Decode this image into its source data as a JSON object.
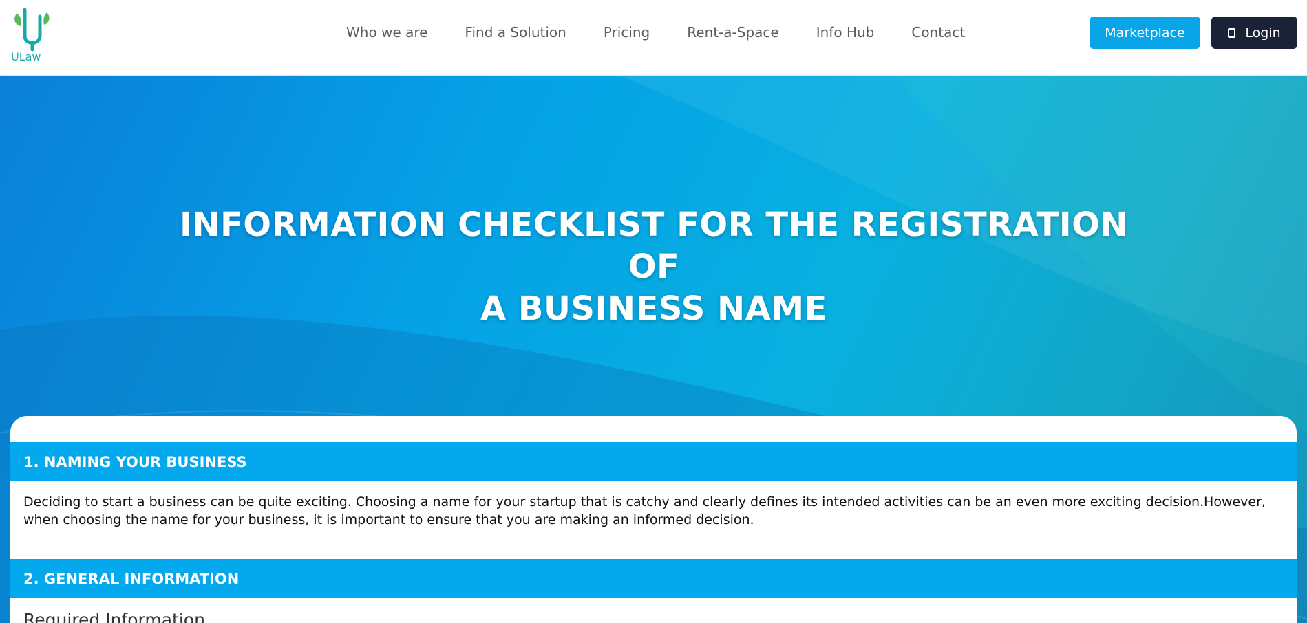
{
  "header": {
    "logo_text": "ULaw",
    "nav": [
      "Who we are",
      "Find a Solution",
      "Pricing",
      "Rent-a-Space",
      "Info Hub",
      "Contact"
    ],
    "marketplace_label": "Marketplace",
    "login_label": "Login"
  },
  "hero": {
    "title_line1": "INFORMATION CHECKLIST FOR THE REGISTRATION OF",
    "title_line2": "A BUSINESS NAME"
  },
  "content": {
    "section1_title": "1. NAMING YOUR BUSINESS",
    "section1_text": "Deciding to start a business can be quite exciting. Choosing a name for your startup that is catchy and clearly defines its intended activities can be an even more exciting decision.However, when choosing the name for your business, it is important to ensure that you are making an informed decision.",
    "section2_title": "2. GENERAL INFORMATION",
    "sub_heading": "Required Information"
  },
  "colors": {
    "accent": "#03a9ec",
    "login_bg": "#1a2238",
    "hero_start": "#0a7fd9",
    "hero_end": "#1693b9"
  },
  "icons": {
    "logo": "ulaw-logo-icon",
    "login": "user-icon"
  }
}
